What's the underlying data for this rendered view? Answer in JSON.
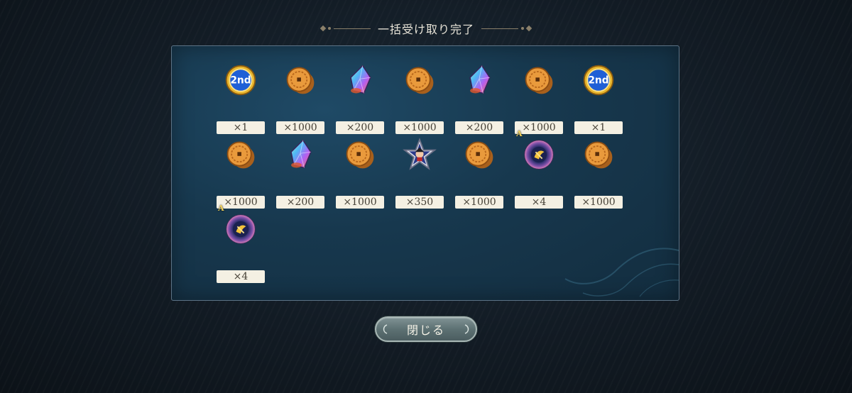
{
  "dialog": {
    "title": "一括受け取り完了",
    "close_label": "閉じる"
  },
  "rewards": [
    {
      "icon": "2nd-anniversary-medal-icon",
      "quantity": "×1"
    },
    {
      "icon": "gold-coin-icon",
      "quantity": "×1000"
    },
    {
      "icon": "rainbow-crystal-icon",
      "quantity": "×200"
    },
    {
      "icon": "gold-coin-icon",
      "quantity": "×1000"
    },
    {
      "icon": "rainbow-crystal-icon",
      "quantity": "×200"
    },
    {
      "icon": "gold-coin-icon",
      "quantity": "×1000"
    },
    {
      "icon": "2nd-anniversary-medal-icon",
      "quantity": "×1"
    },
    {
      "icon": "gold-coin-icon",
      "quantity": "×1000"
    },
    {
      "icon": "rainbow-crystal-icon",
      "quantity": "×200"
    },
    {
      "icon": "gold-coin-icon",
      "quantity": "×1000"
    },
    {
      "icon": "character-star-icon",
      "quantity": "×350"
    },
    {
      "icon": "gold-coin-icon",
      "quantity": "×1000"
    },
    {
      "icon": "awakening-orb-icon",
      "quantity": "×4",
      "rank": "A"
    },
    {
      "icon": "gold-coin-icon",
      "quantity": "×1000"
    },
    {
      "icon": "awakening-orb-icon",
      "quantity": "×4",
      "rank": "A"
    }
  ],
  "colors": {
    "panel": "#17384e",
    "quantity_plate": "#f4f0e3",
    "title_text": "#e8e4d8",
    "rank_badge": "#f3d35a"
  }
}
